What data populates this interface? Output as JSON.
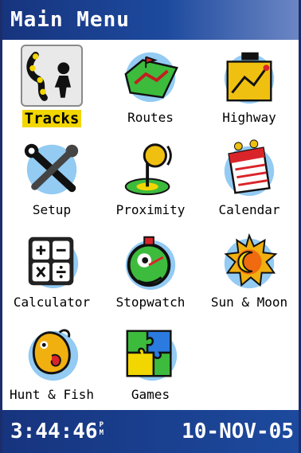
{
  "window": {
    "title": "Main Menu"
  },
  "menu": {
    "items": [
      {
        "label": "Tracks",
        "icon": "tracks-icon",
        "selected": true
      },
      {
        "label": "Routes",
        "icon": "routes-icon",
        "selected": false
      },
      {
        "label": "Highway",
        "icon": "highway-icon",
        "selected": false
      },
      {
        "label": "Setup",
        "icon": "setup-icon",
        "selected": false
      },
      {
        "label": "Proximity",
        "icon": "proximity-icon",
        "selected": false
      },
      {
        "label": "Calendar",
        "icon": "calendar-icon",
        "selected": false
      },
      {
        "label": "Calculator",
        "icon": "calculator-icon",
        "selected": false
      },
      {
        "label": "Stopwatch",
        "icon": "stopwatch-icon",
        "selected": false
      },
      {
        "label": "Sun & Moon",
        "icon": "sun-moon-icon",
        "selected": false
      },
      {
        "label": "Hunt & Fish",
        "icon": "hunt-fish-icon",
        "selected": false
      },
      {
        "label": "Games",
        "icon": "games-icon",
        "selected": false
      }
    ]
  },
  "status": {
    "time": "3:44:46",
    "ampm_top": "P",
    "ampm_bottom": "M",
    "date": "10-NOV-05"
  },
  "colors": {
    "title_bar": "#17347e",
    "selection_highlight": "#f2d600",
    "icon_halo": "#3aa0ea"
  }
}
